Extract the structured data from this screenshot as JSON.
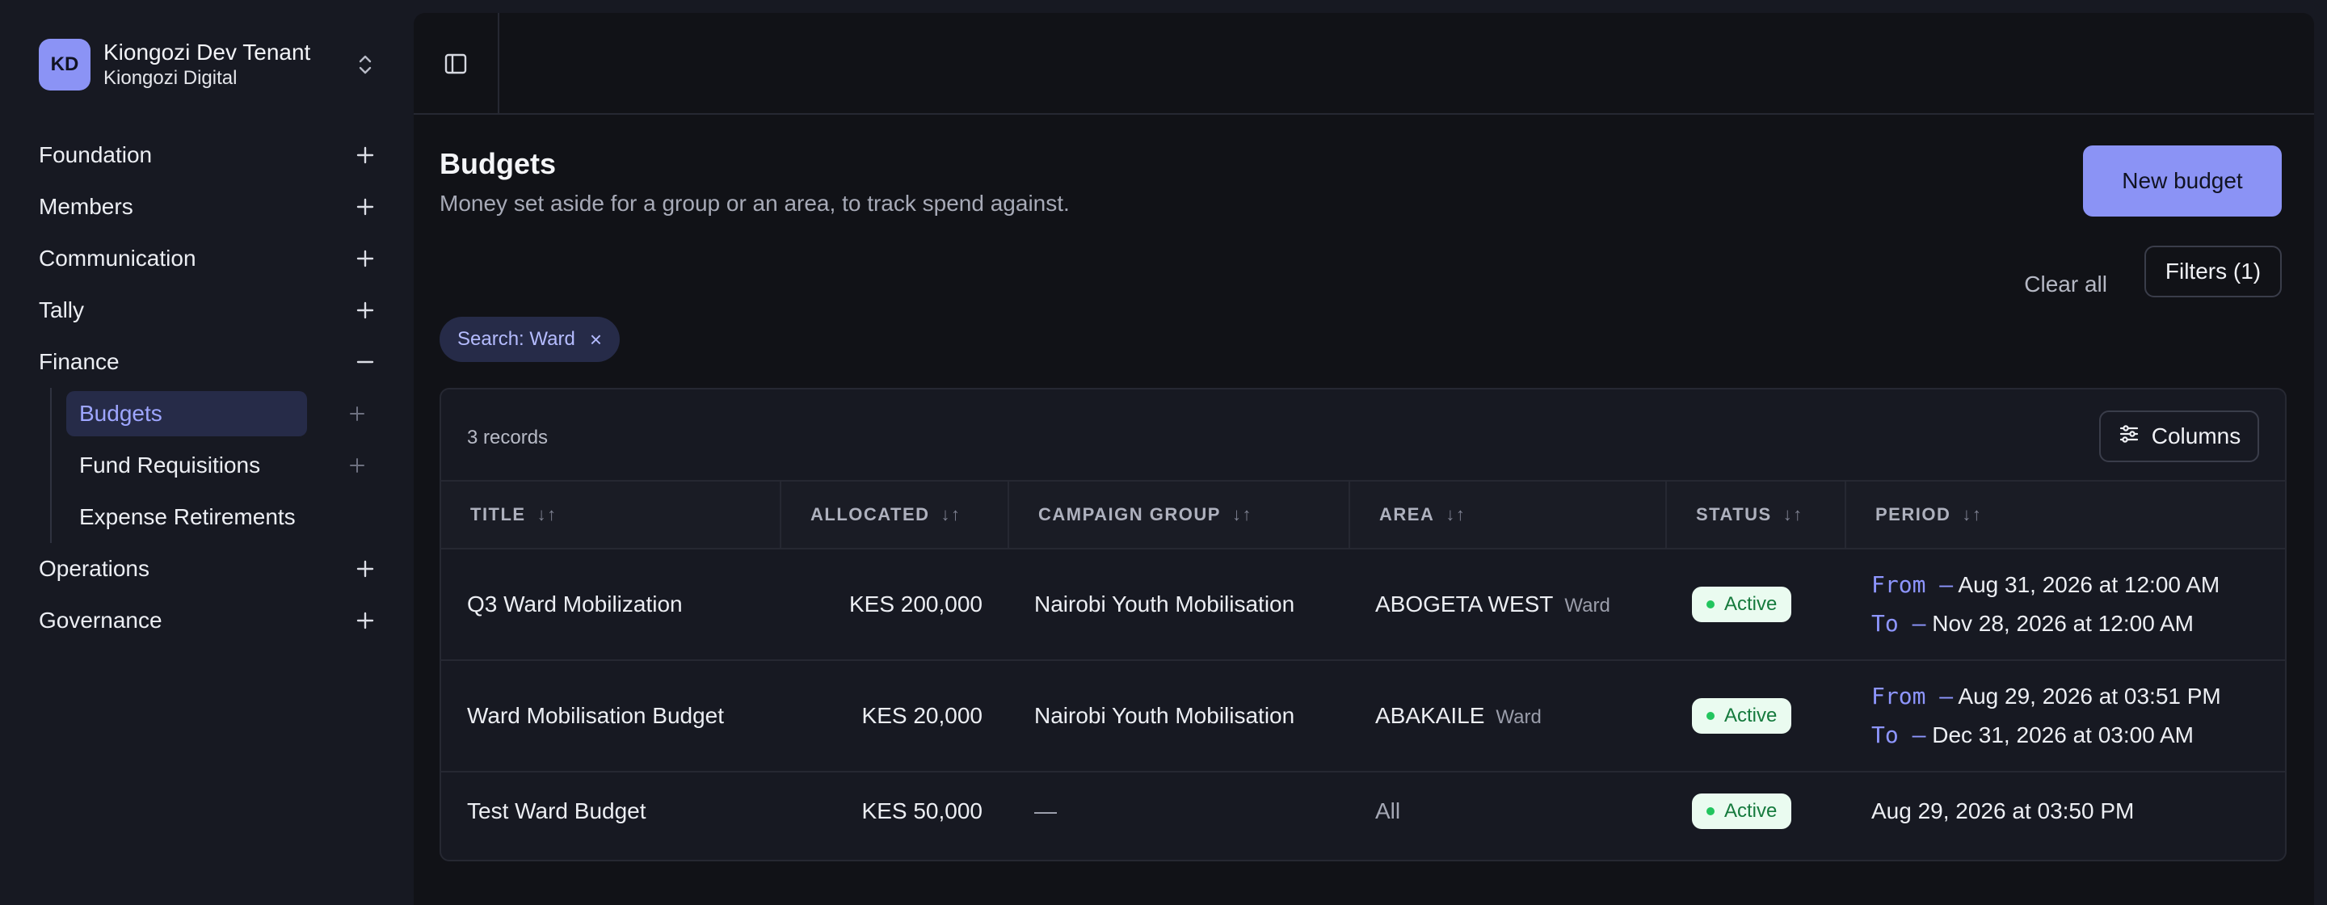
{
  "tenant": {
    "initials": "KD",
    "name": "Kiongozi Dev Tenant",
    "org": "Kiongozi Digital"
  },
  "sidebar": {
    "items": [
      {
        "label": "Foundation",
        "toggle": "+"
      },
      {
        "label": "Members",
        "toggle": "+"
      },
      {
        "label": "Communication",
        "toggle": "+"
      },
      {
        "label": "Tally",
        "toggle": "+"
      },
      {
        "label": "Finance",
        "toggle": "−"
      },
      {
        "label": "Operations",
        "toggle": "+"
      },
      {
        "label": "Governance",
        "toggle": "+"
      }
    ],
    "finance_sub": [
      {
        "label": "Budgets",
        "add": "+"
      },
      {
        "label": "Fund Requisitions",
        "add": "+"
      },
      {
        "label": "Expense Retirements"
      }
    ]
  },
  "page": {
    "title": "Budgets",
    "subtitle": "Money set aside for a group or an area, to track spend against.",
    "new_button": "New budget",
    "clear_all": "Clear all",
    "filters": "Filters (1)",
    "chip": "Search: Ward",
    "chip_close": "×"
  },
  "table": {
    "records": "3 records",
    "columns_button": "Columns",
    "headers": [
      "TITLE",
      "ALLOCATED",
      "CAMPAIGN GROUP",
      "AREA",
      "STATUS",
      "PERIOD"
    ],
    "rows": [
      {
        "title": "Q3 Ward Mobilization",
        "allocated": "KES 200,000",
        "group": "Nairobi Youth Mobilisation",
        "area": "ABOGETA WEST",
        "area_tag": "Ward",
        "status": "Active",
        "from_key": "From –",
        "from": "Aug 31, 2026 at 12:00 AM",
        "to_key": "To –",
        "to": "Nov 28, 2026 at 12:00 AM"
      },
      {
        "title": "Ward Mobilisation Budget",
        "allocated": "KES 20,000",
        "group": "Nairobi Youth Mobilisation",
        "area": "ABAKAILE",
        "area_tag": "Ward",
        "status": "Active",
        "from_key": "From –",
        "from": "Aug 29, 2026 at 03:51 PM",
        "to_key": "To –",
        "to": "Dec 31, 2026 at 03:00 AM"
      },
      {
        "title": "Test Ward Budget",
        "allocated": "KES 50,000",
        "group": "—",
        "area": "All",
        "status": "Active",
        "period": "Aug 29, 2026 at 03:50 PM"
      }
    ]
  }
}
